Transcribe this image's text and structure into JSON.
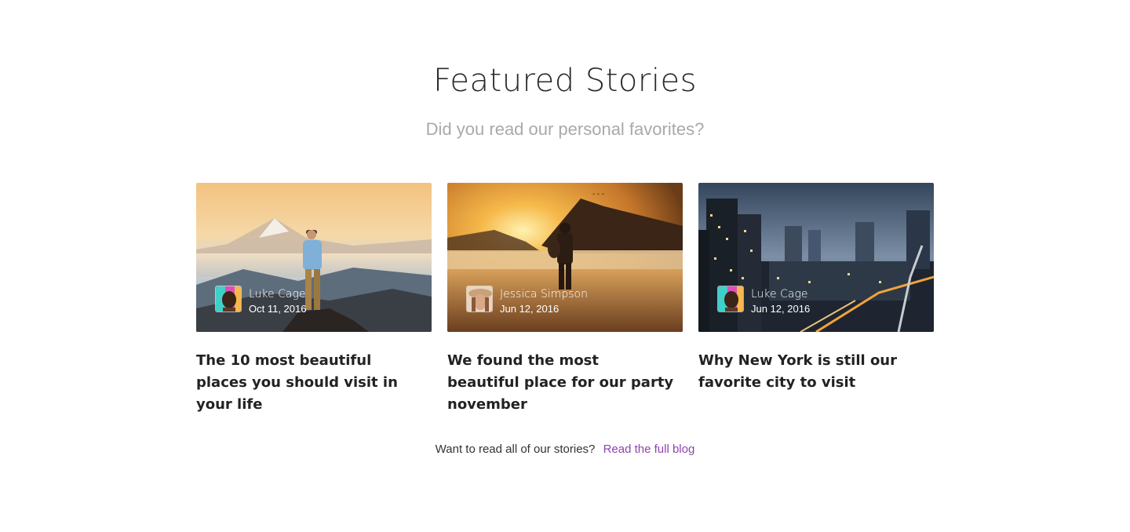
{
  "section": {
    "title": "Featured Stories",
    "subtitle": "Did you read our personal favorites?"
  },
  "cards": [
    {
      "author": "Luke Cage",
      "date": "Oct 11, 2016",
      "title": "The 10 most beautiful places you should visit in your life",
      "image": "mountain-sunrise-hiker"
    },
    {
      "author": "Jessica Simpson",
      "date": "Jun 12, 2016",
      "title": "We found the most beautiful place for our party november",
      "image": "beach-sunset-silhouette"
    },
    {
      "author": "Luke Cage",
      "date": "Jun 12, 2016",
      "title": "Why New York is still our favorite city to visit",
      "image": "city-skyline-dusk"
    }
  ],
  "footer": {
    "text": "Want to read all of our stories?",
    "link_label": "Read the full blog"
  },
  "colors": {
    "link": "#8e44ad",
    "subtitle": "#a9a9a9",
    "title": "#2a2a2a"
  }
}
